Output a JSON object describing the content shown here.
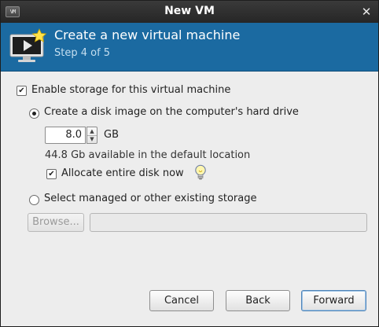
{
  "window": {
    "title": "New VM",
    "icon_text": "VM",
    "close_glyph": "✕"
  },
  "header": {
    "heading": "Create a new virtual machine",
    "step": "Step 4 of 5",
    "background_color": "#1b6aa1"
  },
  "storage": {
    "enable_label": "Enable storage for this virtual machine",
    "enable_checked": true,
    "option_create_label": "Create a disk image on the computer's hard drive",
    "option_create_selected": true,
    "disk_size_value": "8.0",
    "disk_size_unit": "GB",
    "available_text": "44.8 Gb available in the default location",
    "allocate_label": "Allocate entire disk now",
    "allocate_checked": true,
    "option_existing_label": "Select managed or other existing storage",
    "option_existing_selected": false,
    "browse_label": "Browse...",
    "path_value": ""
  },
  "buttons": {
    "cancel": "Cancel",
    "back": "Back",
    "forward": "Forward"
  },
  "icons": {
    "window": "vm-app-icon",
    "close": "close-icon",
    "header": "monitor-star-icon",
    "tip": "lightbulb-icon",
    "check": "✔"
  }
}
